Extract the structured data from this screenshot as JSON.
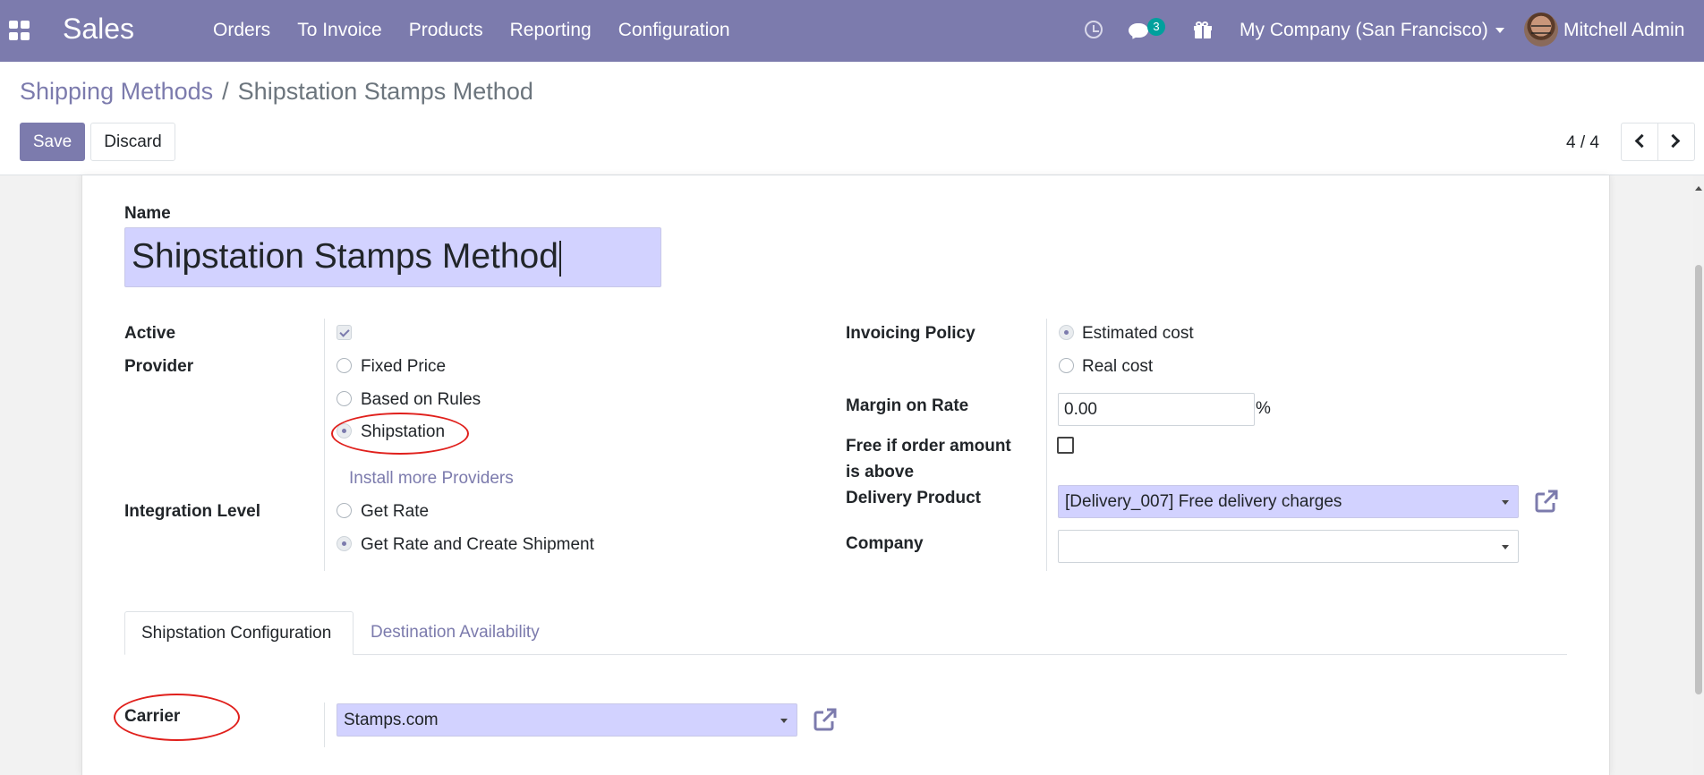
{
  "navbar": {
    "brand": "Sales",
    "menu": [
      "Orders",
      "To Invoice",
      "Products",
      "Reporting",
      "Configuration"
    ],
    "chat_count": "3",
    "company": "My Company (San Francisco)",
    "user": "Mitchell Admin",
    "accent_color": "#7c7bad"
  },
  "breadcrumb": {
    "parent": "Shipping Methods",
    "separator": "/",
    "current": "Shipstation Stamps Method"
  },
  "buttons": {
    "save": "Save",
    "discard": "Discard"
  },
  "pager": {
    "value": "4 / 4"
  },
  "form": {
    "name_label": "Name",
    "name_value": "Shipstation Stamps Method",
    "active_label": "Active",
    "active_checked": true,
    "provider_label": "Provider",
    "provider_options": [
      "Fixed Price",
      "Based on Rules",
      "Shipstation"
    ],
    "provider_selected": "Shipstation",
    "install_link": "Install more Providers",
    "integration_label": "Integration Level",
    "integration_options": [
      "Get Rate",
      "Get Rate and Create Shipment"
    ],
    "integration_selected": "Get Rate and Create Shipment",
    "invoicing_label": "Invoicing Policy",
    "invoicing_options": [
      "Estimated cost",
      "Real cost"
    ],
    "invoicing_selected": "Estimated cost",
    "margin_label": "Margin on Rate",
    "margin_value": "0.00",
    "margin_unit": "%",
    "free_label_1": "Free if order amount",
    "free_label_2": "is above",
    "free_checked": false,
    "delivery_product_label": "Delivery Product",
    "delivery_product_value": "[Delivery_007] Free delivery charges",
    "company_label": "Company",
    "company_value": ""
  },
  "tabs": [
    "Shipstation Configuration",
    "Destination Availability"
  ],
  "shipstation": {
    "carrier_label": "Carrier",
    "carrier_value": "Stamps.com"
  }
}
